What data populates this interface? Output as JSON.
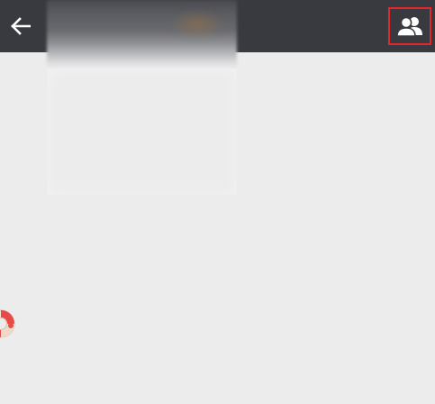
{
  "app_bar": {
    "background": "#393a3f",
    "back_icon": "arrow-left-icon",
    "title": "",
    "members_icon": "group-members-icon",
    "highlight_color": "#e0282e"
  },
  "content": {
    "background": "#ececec"
  },
  "floating_widget": {
    "icon": "lifebuoy-icon",
    "colors": [
      "#e84a4a",
      "#f4e6d6"
    ]
  }
}
